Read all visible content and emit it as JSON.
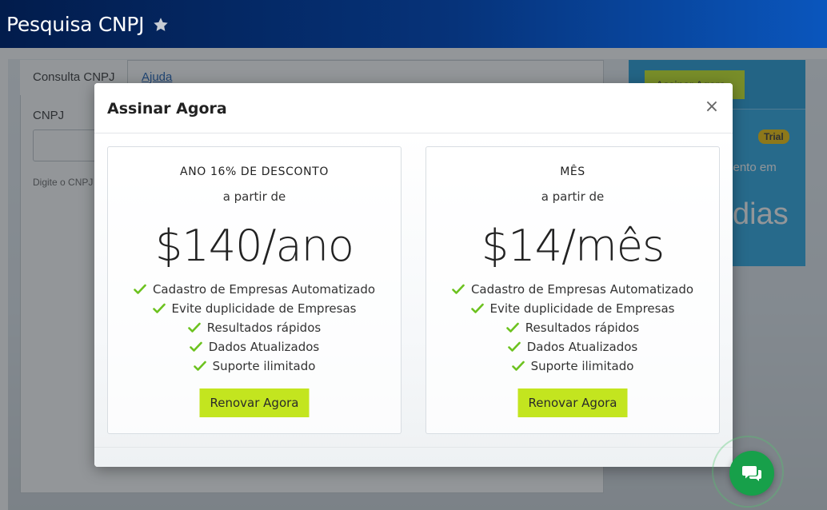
{
  "header": {
    "title": "Pesquisa CNPJ"
  },
  "background_page": {
    "tabs": [
      {
        "label": "Consulta CNPJ"
      },
      {
        "label": "Ajuda"
      }
    ],
    "cnpj_label": "CNPJ",
    "hint": "Digite o CNPJ",
    "side_panel": {
      "button_label": "Assinar Agora",
      "badge": "Trial",
      "text_partial": "mento em",
      "big_text_partial": "dias"
    }
  },
  "modal": {
    "title": "Assinar Agora",
    "close_label": "×",
    "plans": [
      {
        "name": "ANO 16% DE DESCONTO",
        "from": "a partir de",
        "price": "$140/ano",
        "features": [
          "Cadastro de Empresas Automatizado",
          "Evite duplicidade de Empresas",
          "Resultados rápidos",
          "Dados Atualizados",
          "Suporte ilimitado"
        ],
        "button": "Renovar Agora"
      },
      {
        "name": "MÊS",
        "from": "a partir de",
        "price": "$14/mês",
        "features": [
          "Cadastro de Empresas Automatizado",
          "Evite duplicidade de Empresas",
          "Resultados rápidos",
          "Dados Atualizados",
          "Suporte ilimitado"
        ],
        "button": "Renovar Agora"
      }
    ]
  },
  "colors": {
    "header_gradient_start": "#021c4c",
    "header_gradient_end": "#0a56bd",
    "renew_button": "#c3e51f",
    "check_green": "#6cc21f",
    "chat_green": "#17a04a",
    "side_panel_blue": "#27a6e3",
    "trial_badge": "#f2c200"
  },
  "icons": {
    "favorite": "star-icon",
    "close": "close-icon",
    "feature": "check-icon",
    "chat": "chat-bubbles-icon"
  }
}
